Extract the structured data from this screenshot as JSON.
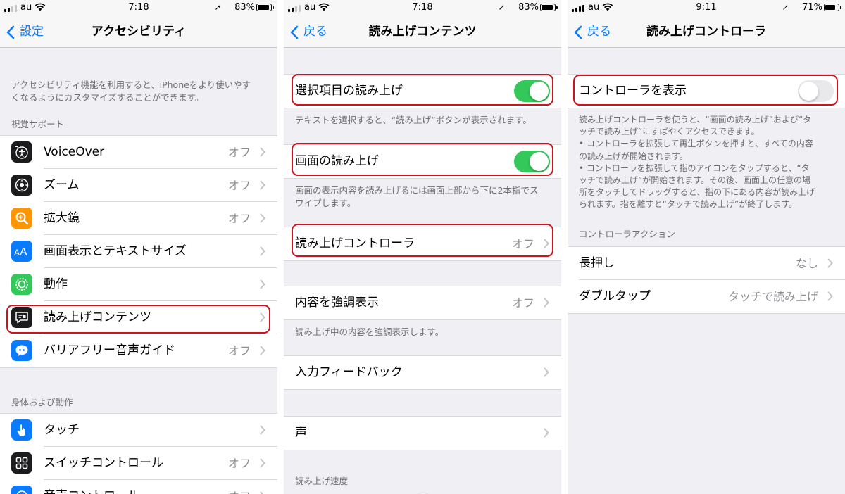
{
  "status_left": {
    "carrier": "au",
    "time": "7:18",
    "battery": "83%",
    "battery_level": 0.83
  },
  "status_mid": {
    "carrier": "au",
    "time": "7:18",
    "battery": "83%",
    "battery_level": 0.83
  },
  "status_right": {
    "carrier": "au",
    "time": "9:11",
    "battery": "71%",
    "battery_level": 0.71
  },
  "panel1": {
    "back_label": "設定",
    "title": "アクセシビリティ",
    "intro": "アクセシビリティ機能を利用すると、iPhoneをより使いやすくなるようにカスタマイズすることができます。",
    "section_vision": "視覚サポート",
    "rows": [
      {
        "label": "VoiceOver",
        "value": "オフ",
        "icon": "voiceover-icon",
        "color": "#000000"
      },
      {
        "label": "ズーム",
        "value": "オフ",
        "icon": "zoom-icon",
        "color": "#000000"
      },
      {
        "label": "拡大鏡",
        "value": "オフ",
        "icon": "magnifier-icon",
        "color": "#ff9500"
      },
      {
        "label": "画面表示とテキストサイズ",
        "value": "",
        "icon": "text-size-icon",
        "color": "#0a7aff"
      },
      {
        "label": "動作",
        "value": "",
        "icon": "motion-icon",
        "color": "#34c759"
      },
      {
        "label": "読み上げコンテンツ",
        "value": "",
        "icon": "spoken-content-icon",
        "color": "#1c1c1e"
      },
      {
        "label": "バリアフリー音声ガイド",
        "value": "オフ",
        "icon": "audio-description-icon",
        "color": "#0a7aff"
      }
    ],
    "section_physical": "身体および動作",
    "rows2": [
      {
        "label": "タッチ",
        "value": "",
        "icon": "touch-icon",
        "color": "#0a7aff"
      },
      {
        "label": "スイッチコントロール",
        "value": "オフ",
        "icon": "switch-control-icon",
        "color": "#000000"
      },
      {
        "label": "音声コントロール",
        "value": "オフ",
        "icon": "voice-control-icon",
        "color": "#0a7aff"
      }
    ]
  },
  "panel2": {
    "back_label": "戻る",
    "title": "読み上げコンテンツ",
    "speak_selection": "選択項目の読み上げ",
    "speak_selection_footer": "テキストを選択すると、“読み上げ”ボタンが表示されます。",
    "speak_screen": "画面の読み上げ",
    "speak_screen_footer": "画面の表示内容を読み上げるには画面上部から下に2本指でスワイプします。",
    "speech_controller": "読み上げコントローラ",
    "speech_controller_value": "オフ",
    "highlight_content": "内容を強調表示",
    "highlight_content_value": "オフ",
    "highlight_footer": "読み上げ中の内容を強調表示します。",
    "typing_feedback": "入力フィードバック",
    "voices": "声",
    "speaking_rate": "読み上げ速度"
  },
  "panel3": {
    "back_label": "戻る",
    "title": "読み上げコントローラ",
    "show_controller": "コントローラを表示",
    "footer_lines": [
      "読み上げコントローラを使うと、“画面の読み上げ”および“タ",
      "ッチで読み上げ”にすばやくアクセスできます。",
      "• コントローラを拡張して再生ボタンを押すと、すべての内容",
      "の読み上げが開始されます。",
      "• コントローラを拡張して指のアイコンをタップすると、“タ",
      "ッチで読み上げ”が開始されます。その後、画面上の任意の場",
      "所をタッチしてドラッグすると、指の下にある内容が読み上げ",
      "られます。指を離すと“タッチで読み上げ”が終了します。"
    ],
    "actions_header": "コントローラアクション",
    "long_press": "長押し",
    "long_press_value": "なし",
    "double_tap": "ダブルタップ",
    "double_tap_value": "タッチで読み上げ"
  }
}
